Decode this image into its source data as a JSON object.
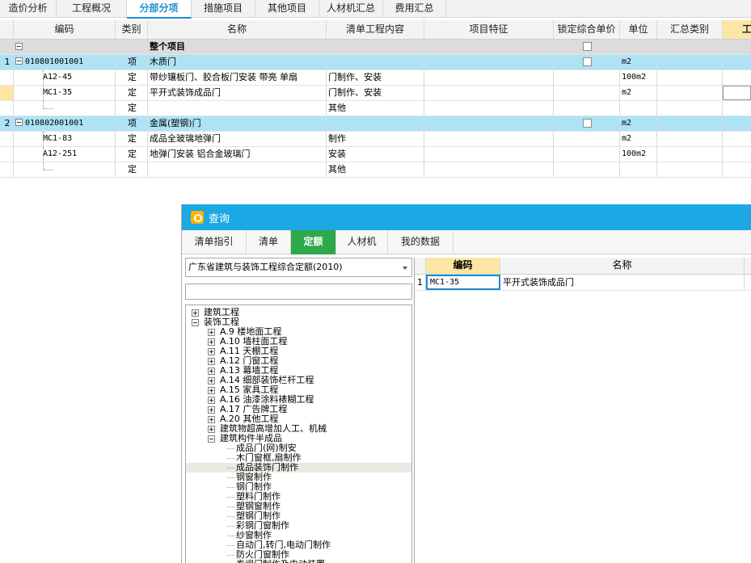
{
  "top_tabs": [
    "造价分析",
    "工程概况",
    "分部分项",
    "措施项目",
    "其他项目",
    "人材机汇总",
    "费用汇总"
  ],
  "grid": {
    "headers": [
      "编码",
      "类别",
      "名称",
      "清单工程内容",
      "项目特征",
      "锁定综合单价",
      "单位",
      "汇总类别",
      "工"
    ],
    "section_label": "整个项目",
    "rows": [
      {
        "num": "1",
        "code": "010801001001",
        "type": "项",
        "name": "木质门",
        "content": "",
        "unit": "m2"
      },
      {
        "num": "",
        "code": "A12-45",
        "type": "定",
        "name": "带纱镶板门、胶合板门安装 带亮 单扇",
        "content": "门制作、安装",
        "unit": "100m2"
      },
      {
        "num": "",
        "code": "MC1-35",
        "type": "定",
        "name": "平开式装饰成品门",
        "content": "门制作、安装",
        "unit": "m2"
      },
      {
        "num": "",
        "code": "",
        "type": "定",
        "name": "",
        "content": "其他",
        "unit": ""
      },
      {
        "num": "2",
        "code": "010802001001",
        "type": "项",
        "name": "金属(塑钢)门",
        "content": "",
        "unit": "m2"
      },
      {
        "num": "",
        "code": "MC1-83",
        "type": "定",
        "name": "成品全玻璃地弹门",
        "content": "制作",
        "unit": "m2"
      },
      {
        "num": "",
        "code": "A12-251",
        "type": "定",
        "name": "地弹门安装 铝合金玻璃门",
        "content": "安装",
        "unit": "100m2"
      },
      {
        "num": "",
        "code": "",
        "type": "定",
        "name": "",
        "content": "其他",
        "unit": ""
      }
    ]
  },
  "dialog": {
    "title": "查询",
    "tabs": [
      "清单指引",
      "清单",
      "定额",
      "人材机",
      "我的数据"
    ],
    "combo_value": "广东省建筑与装饰工程综合定额(2010)",
    "search_value": "",
    "tree": [
      {
        "label": "建筑工程",
        "level": 0,
        "expander": "plus"
      },
      {
        "label": "装饰工程",
        "level": 0,
        "expander": "minus"
      },
      {
        "label": "A.9 楼地面工程",
        "level": 1,
        "expander": "plus"
      },
      {
        "label": "A.10 墙柱面工程",
        "level": 1,
        "expander": "plus"
      },
      {
        "label": "A.11 天棚工程",
        "level": 1,
        "expander": "plus"
      },
      {
        "label": "A.12 门窗工程",
        "level": 1,
        "expander": "plus"
      },
      {
        "label": "A.13 幕墙工程",
        "level": 1,
        "expander": "plus"
      },
      {
        "label": "A.14 细部装饰栏杆工程",
        "level": 1,
        "expander": "plus"
      },
      {
        "label": "A.15 家具工程",
        "level": 1,
        "expander": "plus"
      },
      {
        "label": "A.16 油漆涂料裱糊工程",
        "level": 1,
        "expander": "plus"
      },
      {
        "label": "A.17 广告牌工程",
        "level": 1,
        "expander": "plus"
      },
      {
        "label": "A.20 其他工程",
        "level": 1,
        "expander": "plus"
      },
      {
        "label": "建筑物超高增加人工、机械",
        "level": 1,
        "expander": "plus"
      },
      {
        "label": "建筑构件半成品",
        "level": 1,
        "expander": "minus"
      },
      {
        "label": "成品门(网)制安",
        "level": 2,
        "expander": ""
      },
      {
        "label": "木门窗框,扇制作",
        "level": 2,
        "expander": ""
      },
      {
        "label": "成品装饰门制作",
        "level": 2,
        "expander": "",
        "selected": true
      },
      {
        "label": "钢窗制作",
        "level": 2,
        "expander": ""
      },
      {
        "label": "钢门制作",
        "level": 2,
        "expander": ""
      },
      {
        "label": "塑料门制作",
        "level": 2,
        "expander": ""
      },
      {
        "label": "塑钢窗制作",
        "level": 2,
        "expander": ""
      },
      {
        "label": "塑钢门制作",
        "level": 2,
        "expander": ""
      },
      {
        "label": "彩钢门窗制作",
        "level": 2,
        "expander": ""
      },
      {
        "label": "纱窗制作",
        "level": 2,
        "expander": ""
      },
      {
        "label": "自动门,转门,电动门制作",
        "level": 2,
        "expander": ""
      },
      {
        "label": "防火门窗制作",
        "level": 2,
        "expander": ""
      },
      {
        "label": "卷闸门制作及电动装置",
        "level": 2,
        "expander": ""
      }
    ],
    "result_headers": [
      "编码",
      "名称"
    ],
    "results": [
      {
        "num": "1",
        "code": "MC1-35",
        "name": "平开式装饰成品门"
      }
    ]
  }
}
